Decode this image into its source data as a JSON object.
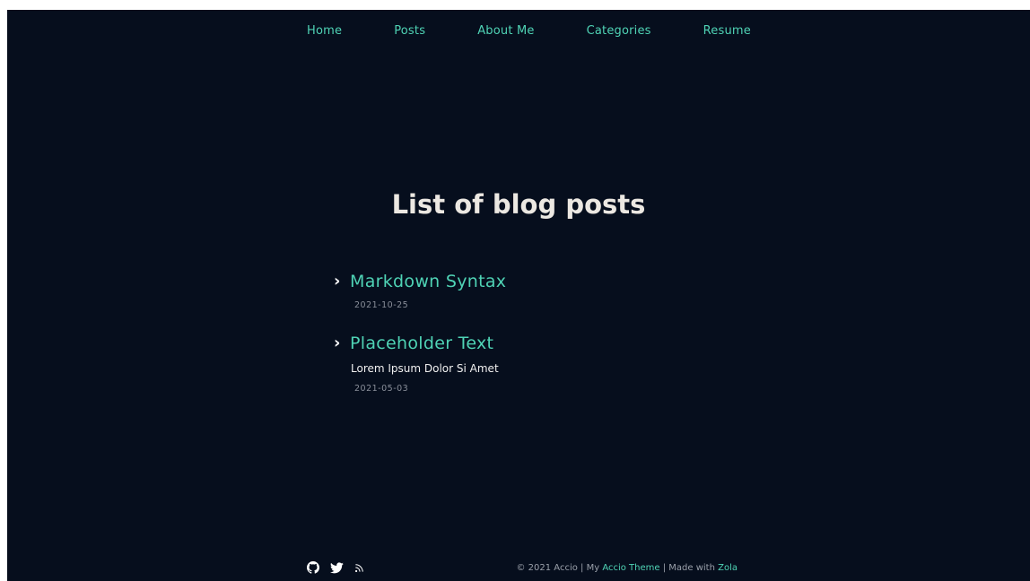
{
  "nav": {
    "items": [
      {
        "label": "Home"
      },
      {
        "label": "Posts"
      },
      {
        "label": "About Me"
      },
      {
        "label": "Categories"
      },
      {
        "label": "Resume"
      }
    ]
  },
  "main": {
    "title": "List of blog posts",
    "posts": [
      {
        "title": "Markdown Syntax",
        "description": "",
        "date": "2021-10-25"
      },
      {
        "title": "Placeholder Text",
        "description": "Lorem Ipsum Dolor Si Amet",
        "date": "2021-05-03"
      }
    ]
  },
  "footer": {
    "icons": [
      "github-icon",
      "twitter-icon",
      "rss-icon"
    ],
    "copyright_prefix": "© 2021 Accio | My",
    "theme_link": "Accio Theme",
    "separator": "| Made with",
    "zola_link": "Zola"
  },
  "colors": {
    "background": "#060e1d",
    "accent": "#4fd3b5",
    "heading": "#ece8e2",
    "muted": "#8a8f9a"
  }
}
